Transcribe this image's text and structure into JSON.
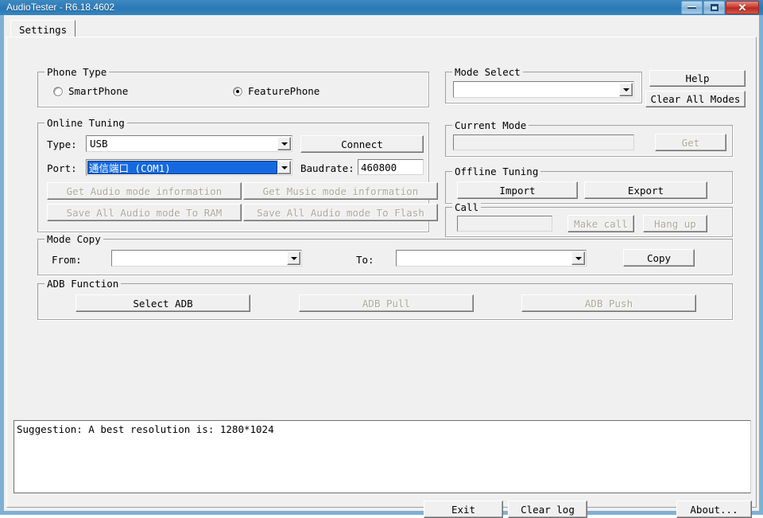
{
  "window": {
    "title": "AudioTester - R6.18.4602",
    "controls": {
      "minimize": "minimize-button",
      "maximize": "maximize-button",
      "close": "✕"
    }
  },
  "tabs": [
    {
      "label": "Settings",
      "selected": true
    }
  ],
  "phone_type": {
    "legend": "Phone Type",
    "options": [
      {
        "label": "SmartPhone",
        "checked": false
      },
      {
        "label": "FeaturePhone",
        "checked": true
      }
    ]
  },
  "online_tuning": {
    "legend": "Online Tuning",
    "type_label": "Type:",
    "type_value": "USB",
    "connect_button": "Connect",
    "port_label": "Port:",
    "port_value": "通信端口 (COM1)",
    "baudrate_label": "Baudrate:",
    "baudrate_value": "460800",
    "buttons": [
      {
        "label": "Get Audio mode information",
        "enabled": false
      },
      {
        "label": "Get Music mode information",
        "enabled": false
      },
      {
        "label": "Save All Audio mode To RAM",
        "enabled": false
      },
      {
        "label": "Save All Audio mode To Flash",
        "enabled": false
      }
    ]
  },
  "mode_select": {
    "legend": "Mode Select",
    "value": "",
    "help_button": "Help",
    "clear_all_modes_button": "Clear All Modes"
  },
  "current_mode": {
    "legend": "Current Mode",
    "value": "",
    "get_button": "Get"
  },
  "offline_tuning": {
    "legend": "Offline Tuning",
    "import_button": "Import",
    "export_button": "Export"
  },
  "call": {
    "legend": "Call",
    "number_value": "",
    "make_call_button": "Make call",
    "hang_up_button": "Hang up"
  },
  "mode_copy": {
    "legend": "Mode Copy",
    "from_label": "From:",
    "from_value": "",
    "to_label": "To:",
    "to_value": "",
    "copy_button": "Copy"
  },
  "adb_function": {
    "legend": "ADB Function",
    "select_adb_button": "Select ADB",
    "adb_pull_button": "ADB Pull",
    "adb_push_button": "ADB Push"
  },
  "log": {
    "lines": [
      "Suggestion: A best resolution is: 1280*1024"
    ],
    "line0": "Suggestion: A best resolution is: 1280*1024"
  },
  "footer": {
    "exit_button": "Exit",
    "clear_log_button": "Clear log",
    "about_button": "About..."
  },
  "colors": {
    "titlebar": "#2E7CB8",
    "window_border": "#84B0D0",
    "face": "#F0F0F0",
    "selection_blue": "#1569E0",
    "disabled_text": "#ACA899",
    "close_red": "#C8382C"
  }
}
